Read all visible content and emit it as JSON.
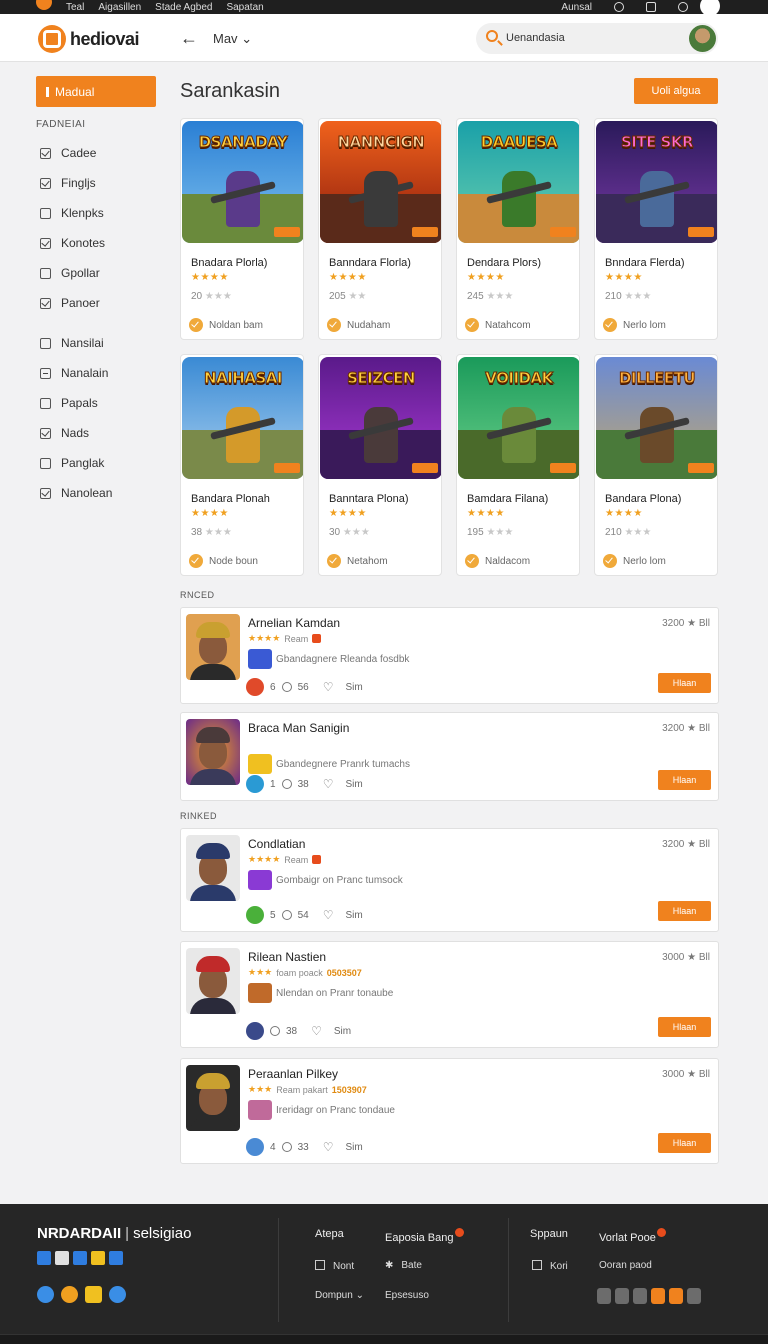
{
  "system_bar": {
    "items": [
      "Teal",
      "Aigasillen",
      "Stade Agbed",
      "Sapatan"
    ],
    "right_label": "Aunsal"
  },
  "header": {
    "logo_text": "hediovai",
    "nav_label": "Mav",
    "search_value": "Uenandasia"
  },
  "sidebar": {
    "primary_button": "Madual",
    "heading": "FADNEIAI",
    "filters": [
      {
        "label": "Cadee",
        "state": "checked"
      },
      {
        "label": "Fingljs",
        "state": "checked"
      },
      {
        "label": "Klenpks",
        "state": "unchecked"
      },
      {
        "label": "Konotes",
        "state": "checked"
      },
      {
        "label": "Gpollar",
        "state": "unchecked"
      },
      {
        "label": "Panoer",
        "state": "checked"
      }
    ],
    "filters2": [
      {
        "label": "Nansilai",
        "state": "unchecked"
      },
      {
        "label": "Nanalain",
        "state": "indeterminate"
      },
      {
        "label": "Papals",
        "state": "unchecked"
      },
      {
        "label": "Nads",
        "state": "checked"
      },
      {
        "label": "Panglak",
        "state": "unchecked"
      },
      {
        "label": "Nanolean",
        "state": "checked"
      }
    ]
  },
  "main": {
    "title": "Sarankasin",
    "top_button": "Uoli algua",
    "games": [
      {
        "art_title": "DSANADAY",
        "name": "Bnadara Plorla)",
        "stars": "★★★★",
        "rating": "20",
        "rating_stars": "★★★",
        "publisher": "Noldan bam",
        "theme": "a"
      },
      {
        "art_title": "NANNCIGN",
        "name": "Banndara Florla)",
        "stars": "★★★★",
        "rating": "205",
        "rating_stars": "★★",
        "publisher": "Nudaham",
        "theme": "b"
      },
      {
        "art_title": "DAAUESA",
        "name": "Dendara Plors)",
        "stars": "★★★★",
        "rating": "245",
        "rating_stars": "★★★",
        "publisher": "Natahcom",
        "theme": "c"
      },
      {
        "art_title": "SITE SKR",
        "name": "Bnndara Flerda)",
        "stars": "★★★★",
        "rating": "210",
        "rating_stars": "★★★",
        "publisher": "Nerlo lom",
        "theme": "d"
      },
      {
        "art_title": "NAIHASAI",
        "name": "Bandara Plonah",
        "stars": "★★★★",
        "rating": "38",
        "rating_stars": "★★★",
        "publisher": "Node boun",
        "theme": "e"
      },
      {
        "art_title": "SEIZCEN",
        "name": "Banntara Plona)",
        "stars": "★★★★",
        "rating": "30",
        "rating_stars": "★★★",
        "publisher": "Netahom",
        "theme": "f"
      },
      {
        "art_title": "VOIIDAK",
        "name": "Bamdara Filana)",
        "stars": "★★★★",
        "rating": "195",
        "rating_stars": "★★★",
        "publisher": "Naldacom",
        "theme": "g"
      },
      {
        "art_title": "DILLEETU",
        "name": "Bandara Plona)",
        "stars": "★★★★",
        "rating": "210",
        "rating_stars": "★★★",
        "publisher": "Nerlo lom",
        "theme": "h"
      }
    ],
    "section1_label": "RNCED",
    "section2_label": "RINKED",
    "list1": [
      {
        "name": "Arnelian Kamdan",
        "stars": "★★★★",
        "meta": "Ream",
        "code": "",
        "desc": "Gbandagnere Rleanda fosdbk",
        "likes": "6",
        "comments": "56",
        "share": "Sim",
        "price": "3200 ★ Bll",
        "button": "Hlaan",
        "theme": "p1"
      },
      {
        "name": "Braca Man Sanigin",
        "stars": "",
        "meta": "",
        "code": "",
        "desc": "Gbandegnere Pranrk tumachs",
        "likes": "1",
        "comments": "38",
        "share": "Sim",
        "price": "3200 ★ Bll",
        "button": "Hlaan",
        "theme": "p2"
      }
    ],
    "list2": [
      {
        "name": "Condlatian",
        "stars": "★★★★",
        "meta": "Ream",
        "code": "",
        "desc": "Gombaigr on Pranc tumsock",
        "likes": "5",
        "comments": "54",
        "share": "Sim",
        "price": "3200 ★ Bll",
        "button": "Hlaan",
        "theme": "p3"
      },
      {
        "name": "Rilean Nastien",
        "stars": "★★★",
        "meta": "foam poack",
        "code": "0503507",
        "desc": "Nlendan on Pranr tonaube",
        "likes": "",
        "comments": "38",
        "share": "Sim",
        "price": "3000 ★ Bll",
        "button": "Hlaan",
        "theme": "p4"
      },
      {
        "name": "Peraanlan Pilkey",
        "stars": "★★★",
        "meta": "Ream pakart",
        "code": "1503907",
        "desc": "Ireridagr on Pranc tondaue",
        "likes": "4",
        "comments": "33",
        "share": "Sim",
        "price": "3000 ★ Bll",
        "button": "Hlaan",
        "theme": "p5"
      }
    ]
  },
  "footer": {
    "brand": "NRDARDAII",
    "brand_sub": "selsigiao",
    "col1": [
      "Atepa",
      "Nont",
      "Dompun"
    ],
    "col2": [
      "Eaposia Bang",
      "Bate",
      "Epsesuso"
    ],
    "col3": [
      "Sppaun",
      "Kori"
    ],
    "col4": [
      "Vorlat Pooe",
      "Ooran paod"
    ]
  },
  "colors": {
    "accent": "#f0821e",
    "footer_bg": "#262626",
    "page_bg": "#f2f2f3"
  },
  "icons": [
    "search-icon",
    "back-arrow-icon",
    "chevron-down-icon",
    "check-icon",
    "heart-icon",
    "comment-icon",
    "star-icon"
  ]
}
